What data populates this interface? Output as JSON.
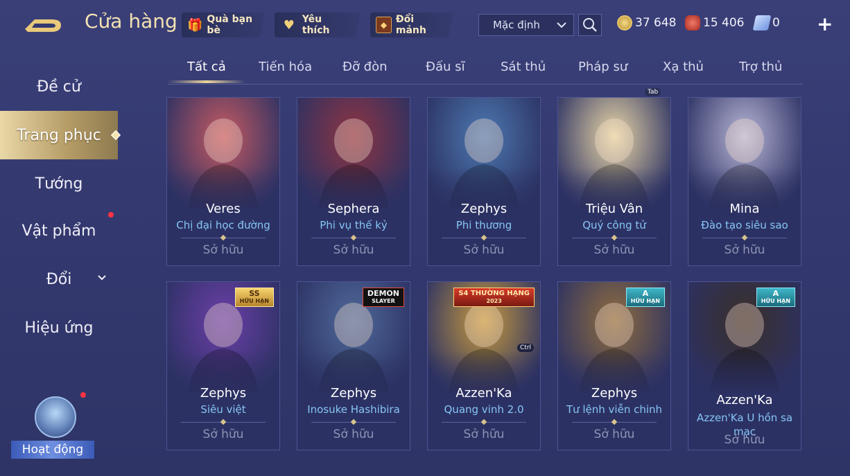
{
  "header": {
    "title": "Cửa hàng",
    "buttons": [
      {
        "label": "Quà bạn bè",
        "icon": "gift-icon"
      },
      {
        "label": "Yêu thích",
        "icon": "heart-icon"
      },
      {
        "label": "Đổi mảnh",
        "icon": "shard-chest-icon"
      }
    ],
    "sort": {
      "selected": "Mặc định"
    },
    "currencies": [
      {
        "name": "gold",
        "value": "37 648",
        "color": "#d9b34e"
      },
      {
        "name": "ruby",
        "value": "15 406",
        "color": "#d9463f"
      },
      {
        "name": "voucher",
        "value": "0",
        "color": "#8fb4ef"
      }
    ]
  },
  "sidebar": {
    "items": [
      {
        "label": "Đề cử",
        "active": false
      },
      {
        "label": "Trang phục",
        "active": true
      },
      {
        "label": "Tướng",
        "active": false
      },
      {
        "label": "Vật phẩm",
        "active": false,
        "notification": true
      },
      {
        "label": "Đổi",
        "active": false,
        "expandable": true
      },
      {
        "label": "Hiệu ứng",
        "active": false
      }
    ],
    "activity_label": "Hoạt động"
  },
  "tabs": [
    "Tất cả",
    "Tiến hóa",
    "Đỡ đòn",
    "Đấu sĩ",
    "Sát thủ",
    "Pháp sư",
    "Xạ thủ",
    "Trợ thủ"
  ],
  "active_tab": 0,
  "hints": {
    "tab": "Tab",
    "ctrl": "Ctrl"
  },
  "cards": [
    {
      "hero": "Veres",
      "skin": "Chị đại học đường",
      "status": "Sở hữu",
      "art_color": "#c55a62"
    },
    {
      "hero": "Sephera",
      "skin": "Phi vụ thế kỷ",
      "status": "Sở hữu",
      "art_color": "#8e3442"
    },
    {
      "hero": "Zephys",
      "skin": "Phi thương",
      "status": "Sở hữu",
      "art_color": "#4c79b0"
    },
    {
      "hero": "Triệu Vân",
      "skin": "Quý công tử",
      "status": "Sở hữu",
      "art_color": "#e8d6a6"
    },
    {
      "hero": "Mina",
      "skin": "Đào tạo siêu sao",
      "status": "Sở hữu",
      "art_color": "#b8b6d6"
    },
    {
      "hero": "Zephys",
      "skin": "Siêu việt",
      "status": "Sở hữu",
      "art_color": "#6b3fa8",
      "badge": {
        "line1": "SS",
        "line2": "HỮU HẠN",
        "style": "gold"
      }
    },
    {
      "hero": "Zephys",
      "skin": "Inosuke Hashibira",
      "status": "Sở hữu",
      "art_color": "#4f6a9a",
      "badge": {
        "line1": "DEMON",
        "line2": "SLAYER",
        "style": "collab"
      }
    },
    {
      "hero": "Azzen'Ka",
      "skin": "Quang vinh 2.0",
      "status": "Sở hữu",
      "art_color": "#c79b3f",
      "badge": {
        "line1": "S4 THƯỜNG HẠNG",
        "line2": "2023",
        "style": "rank"
      }
    },
    {
      "hero": "Zephys",
      "skin": "Tư lệnh viễn chinh",
      "status": "Sở hữu",
      "art_color": "#8f6d3e",
      "badge": {
        "line1": "A",
        "line2": "HỮU HẠN",
        "style": "teal"
      }
    },
    {
      "hero": "Azzen'Ka",
      "skin": "Azzen'Ka U hồn sa mạc",
      "status": "Sở hữu",
      "art_color": "#3a2f2a",
      "badge": {
        "line1": "A",
        "line2": "HỮU HẠN",
        "style": "teal"
      }
    }
  ]
}
